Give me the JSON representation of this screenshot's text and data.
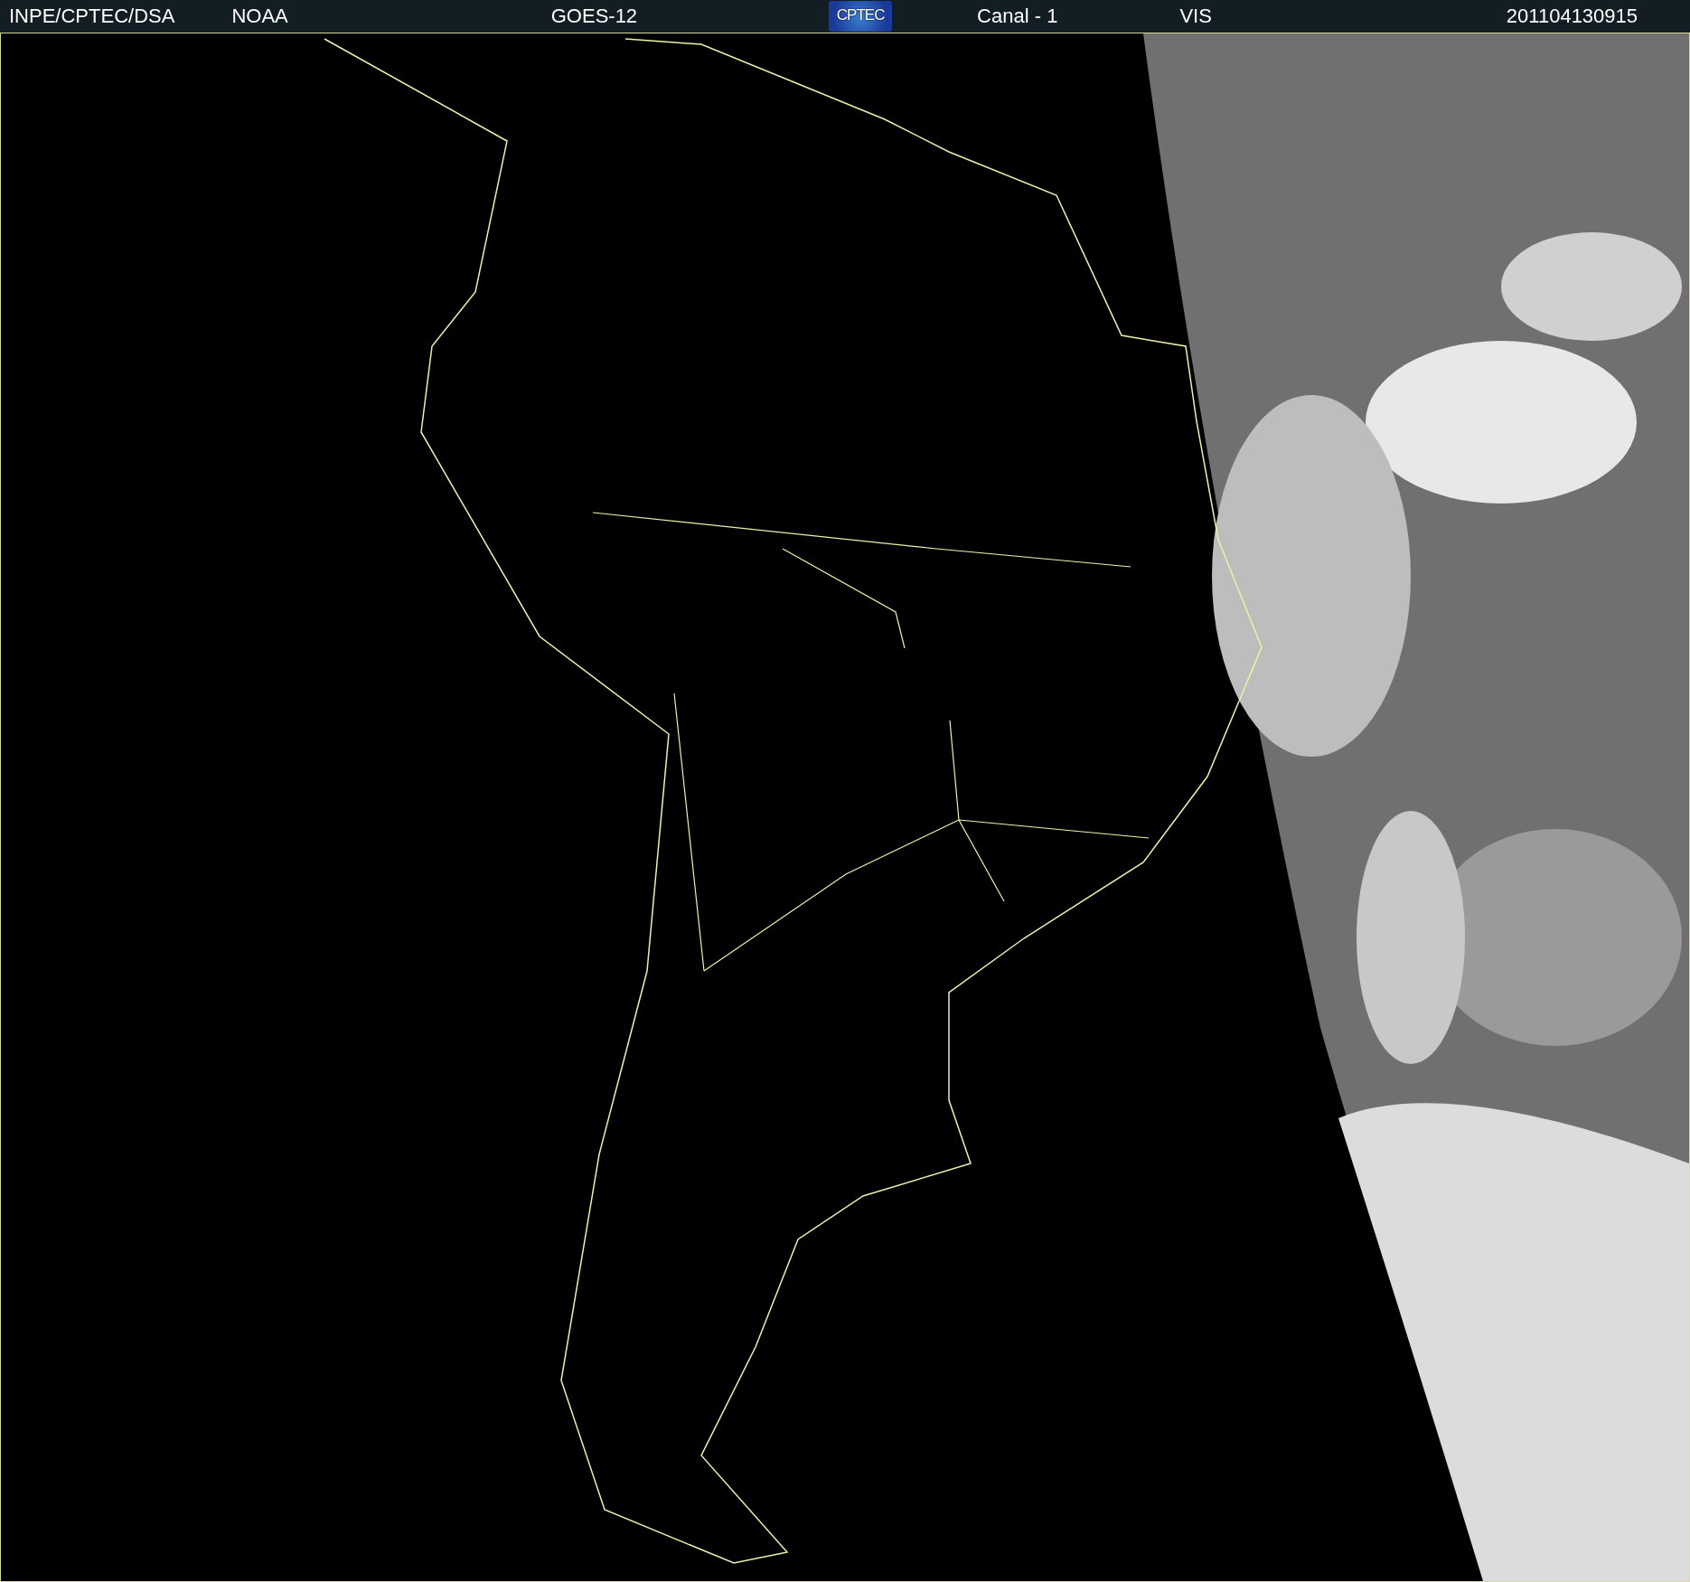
{
  "header": {
    "items": [
      {
        "kind": "text",
        "text": "INPE/CPTEC/DSA"
      },
      {
        "kind": "text",
        "text": "NOAA"
      },
      {
        "kind": "text",
        "text": "GOES-12"
      },
      {
        "kind": "logo",
        "text": "CPTEC"
      },
      {
        "kind": "text",
        "text": "Canal - 1"
      },
      {
        "kind": "text",
        "text": "VIS"
      },
      {
        "kind": "text",
        "text": "201104130915"
      }
    ]
  }
}
